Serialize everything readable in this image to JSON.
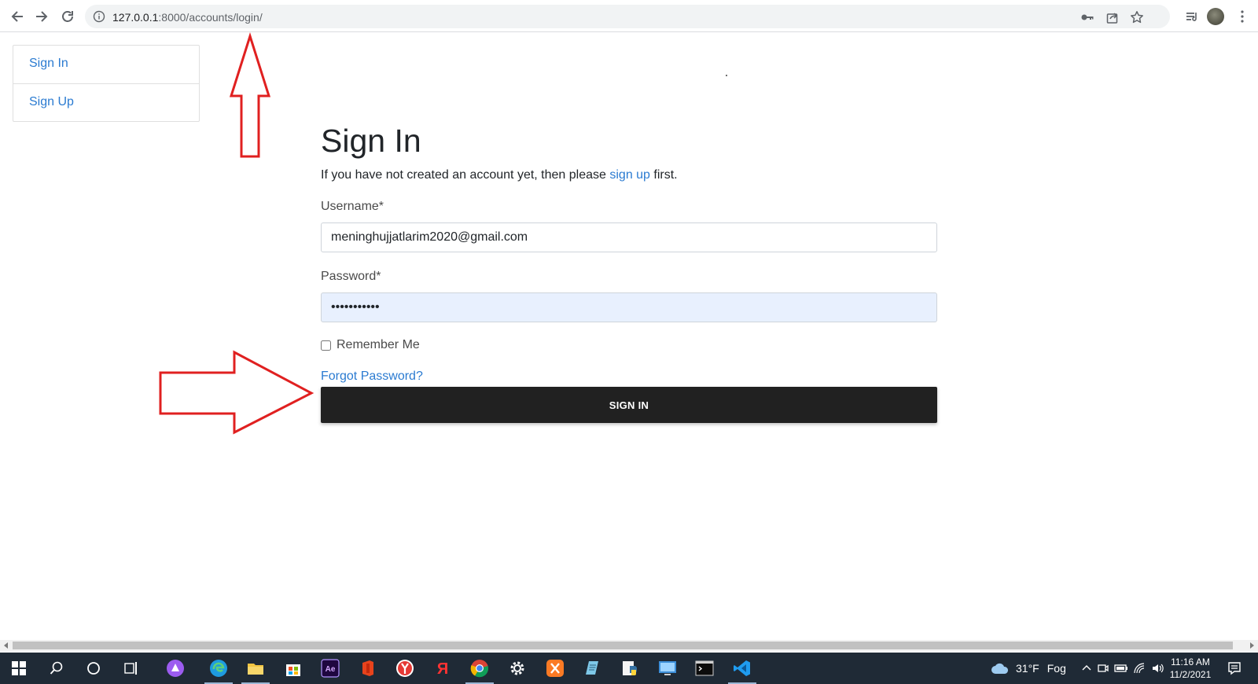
{
  "browser": {
    "url_host": "127.0.0.1",
    "url_path": ":8000/accounts/login/"
  },
  "sidebar": {
    "items": [
      {
        "label": "Sign In"
      },
      {
        "label": "Sign Up"
      }
    ]
  },
  "form": {
    "title": "Sign In",
    "intro_before": "If you have not created an account yet, then please ",
    "intro_link": "sign up",
    "intro_after": " first.",
    "username_label": "Username*",
    "username_value": "meninghujjatlarim2020@gmail.com",
    "password_label": "Password*",
    "password_value": "•••••••••••",
    "remember_label": "Remember Me",
    "forgot_link": "Forgot Password?",
    "submit_label": "SIGN IN"
  },
  "taskbar": {
    "weather_temp": "31°F",
    "weather_desc": "Fog",
    "time": "11:16 AM",
    "date": "11/2/2021"
  },
  "colors": {
    "link": "#2b7bd1",
    "button_bg": "#212121",
    "annotation": "#e02020",
    "autofill_bg": "#e8f0fe",
    "taskbar_bg": "#1f2a36"
  },
  "icons": {
    "toolbar": [
      "back-arrow-icon",
      "forward-arrow-icon",
      "reload-icon",
      "info-icon",
      "key-icon",
      "share-icon",
      "star-icon",
      "reading-list-icon",
      "profile-avatar",
      "kebab-menu-icon"
    ],
    "taskbar": [
      "windows-start-icon",
      "search-icon",
      "cortana-icon",
      "task-view-icon",
      "alice-icon",
      "edge-icon",
      "file-explorer-icon",
      "store-icon",
      "after-effects-icon",
      "office-icon",
      "yandex-browser-icon",
      "yandex-icon",
      "chrome-icon",
      "settings-icon",
      "xampp-icon",
      "notepad-icon",
      "python-icon",
      "remote-desktop-icon",
      "terminal-icon",
      "vscode-icon"
    ]
  }
}
